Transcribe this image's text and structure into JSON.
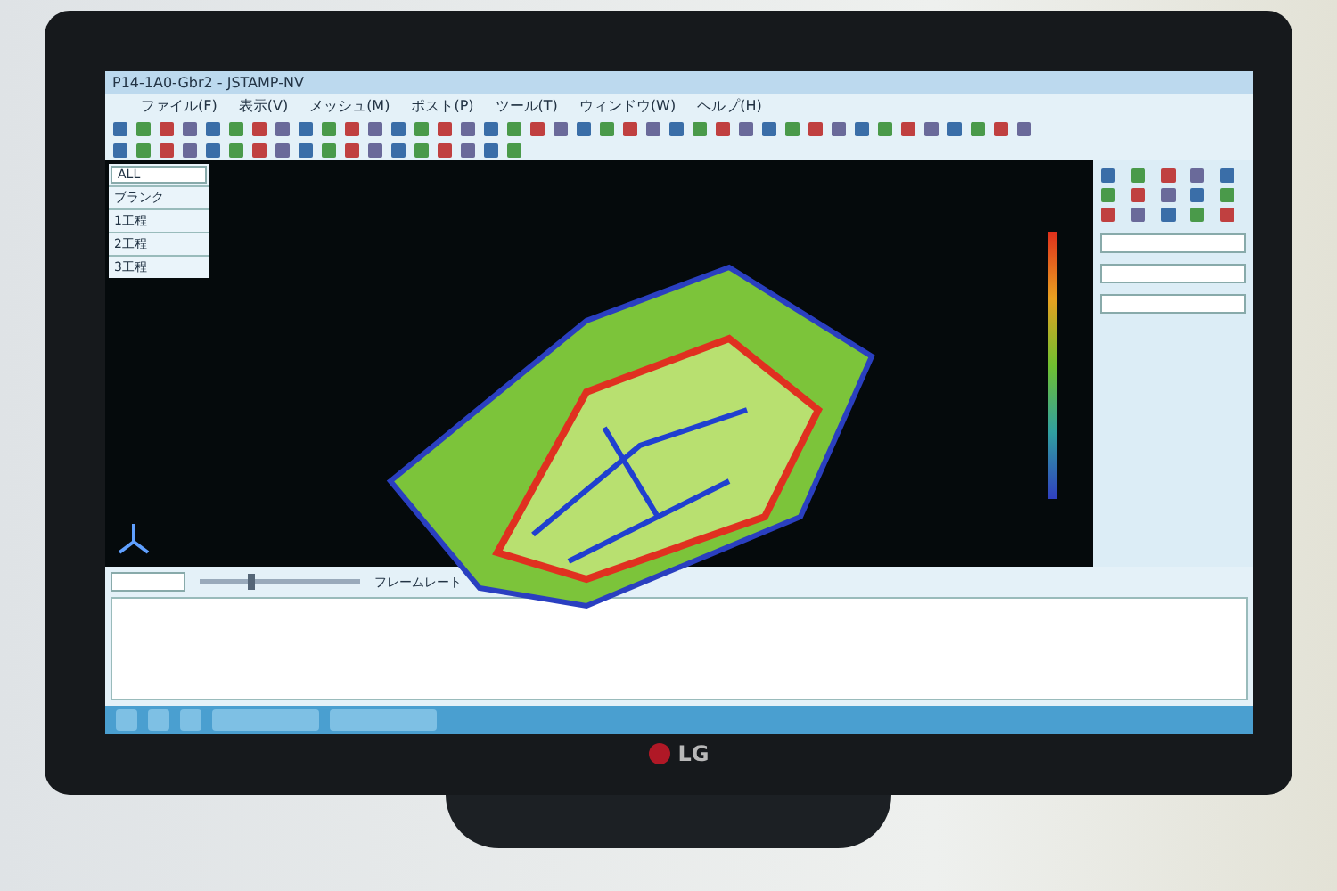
{
  "window": {
    "title": "P14-1A0-Gbr2 - JSTAMP-NV"
  },
  "menu": [
    "ファイル(F)",
    "表示(V)",
    "メッシュ(M)",
    "ポスト(P)",
    "ツール(T)",
    "ウィンドウ(W)",
    "ヘルプ(H)"
  ],
  "filter": {
    "value": "ALL"
  },
  "process_list": [
    "ブランク",
    "1工程",
    "2工程",
    "3工程"
  ],
  "bottom_panel": {
    "slider_label": "フレームレート",
    "level": 0.3
  },
  "monitor": {
    "brand": "LG"
  }
}
